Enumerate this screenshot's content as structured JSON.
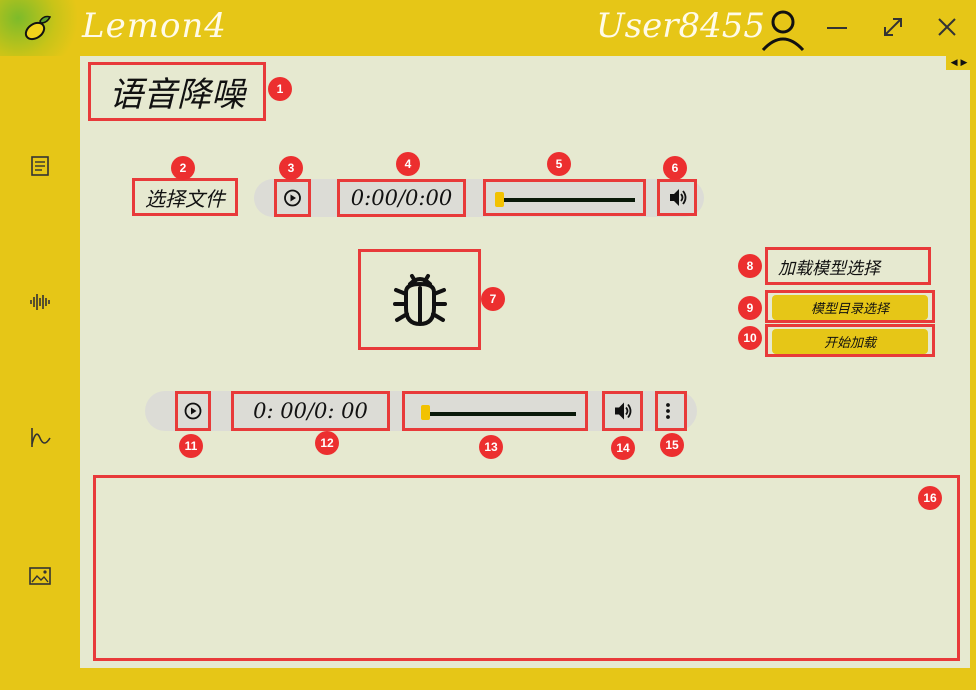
{
  "app": {
    "title": "Lemon4",
    "user": "User8455"
  },
  "page": {
    "title": "语音降噪"
  },
  "input_player": {
    "select_file_label": "选择文件",
    "time": "0:00/0:00",
    "progress": 0.0
  },
  "model": {
    "load_model_label": "加载模型选择",
    "select_dir_button": "模型目录选择",
    "start_load_button": "开始加载"
  },
  "output_player": {
    "time": "0: 00/0: 00",
    "progress": 0.0
  },
  "badges": {
    "b1": "1",
    "b2": "2",
    "b3": "3",
    "b4": "4",
    "b5": "5",
    "b6": "6",
    "b7": "7",
    "b8": "8",
    "b9": "9",
    "b10": "10",
    "b11": "11",
    "b12": "12",
    "b13": "13",
    "b14": "14",
    "b15": "15",
    "b16": "16"
  },
  "icons": {
    "logo": "lemon-logo-icon",
    "user": "user-icon",
    "minimize": "minimize-icon",
    "maximize": "maximize-icon",
    "close": "close-icon",
    "sidebar": [
      "document-icon",
      "waveform-icon",
      "curve-icon",
      "image-icon"
    ],
    "play": "play-icon",
    "volume": "volume-icon",
    "bug": "bug-icon",
    "more": "more-vertical-icon"
  },
  "colors": {
    "accent": "#e6c617",
    "background": "#e6e9d0",
    "highlight_box": "#e83a3a",
    "badge": "#ec2f2f"
  }
}
